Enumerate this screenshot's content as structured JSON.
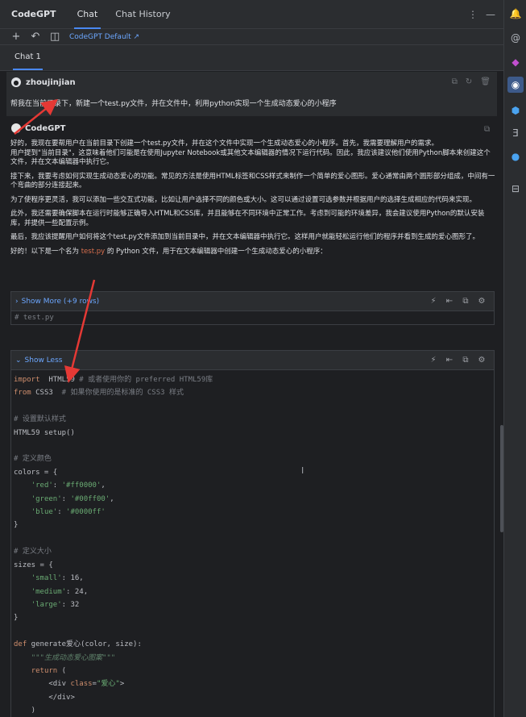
{
  "header": {
    "app_title": "CodeGPT",
    "tabs": [
      "Chat",
      "Chat History"
    ]
  },
  "toolbar": {
    "model_link": "CodeGPT Default ↗"
  },
  "chat_tab": "Chat 1",
  "user_message": {
    "username": "zhoujinjian",
    "text": "帮我在当前目录下，新建一个test.py文件，并在文件中，利用python实现一个生成动态爱心的小程序"
  },
  "bot_message": {
    "name": "CodeGPT",
    "paragraphs": [
      "好的，我现在要帮用户在当前目录下创建一个test.py文件，并在这个文件中实现一个生成动态爱心的小程序。首先，我需要理解用户的需求。",
      "用户提到\"当前目录\"，这意味着他们可能是在使用Jupyter Notebook或其他文本编辑器的情况下运行代码。因此，我应该建议他们使用Python脚本来创建这个文件，并在文本编辑器中执行它。",
      "接下来，我要考虑如何实现生成动态爱心的功能。常见的方法是使用HTML标签和CSS样式来制作一个简单的爱心图形。爱心通常由两个圆形部分组成，中间有一个弯曲的部分连接起来。",
      "为了使程序更灵活，我可以添加一些交互式功能，比如让用户选择不同的颜色或大小。这可以通过设置可选参数并根据用户的选择生成相应的代码来实现。",
      "此外，我还需要确保脚本在运行时能够正确导入HTML和CSS库，并且能够在不同环境中正常工作。考虑到可能的环境差异，我会建议使用Python的默认安装库，并提供一些配置示例。",
      "最后，我应该提醒用户如何将这个test.py文件添加到当前目录中，并在文本编辑器中执行它。这样用户就能轻松运行他们的程序并看到生成的爱心图形了。"
    ],
    "closing_prefix": "好的！以下是一个名为 ",
    "closing_file": "test.py",
    "closing_suffix": " 的 Python 文件，用于在文本编辑器中创建一个生成动态爱心的小程序："
  },
  "code_block_1": {
    "toggle_label": "Show More (+9 rows)",
    "first_line": "# test.py"
  },
  "code_block_2": {
    "toggle_label": "Show Less"
  },
  "code_lines": [
    [
      [
        "kw",
        "import"
      ],
      [
        "",
        "  HTML59 "
      ],
      [
        "cm",
        "# 或者使用你的 preferred HTML59库"
      ]
    ],
    [
      [
        "kw",
        "from"
      ],
      [
        "",
        " CSS3  "
      ],
      [
        "cm",
        "# 如果你使用的是标准的 CSS3 样式"
      ]
    ],
    [],
    [
      [
        "cm",
        "# 设置默认样式"
      ]
    ],
    [
      [
        "",
        "HTML59 setup()"
      ]
    ],
    [],
    [
      [
        "cm",
        "# 定义颜色"
      ]
    ],
    [
      [
        "",
        "colors = {"
      ]
    ],
    [
      [
        "",
        "    "
      ],
      [
        "st",
        "'red'"
      ],
      [
        "",
        ": "
      ],
      [
        "st",
        "'#ff0000'"
      ],
      [
        "",
        ","
      ]
    ],
    [
      [
        "",
        "    "
      ],
      [
        "st",
        "'green'"
      ],
      [
        "",
        ": "
      ],
      [
        "st",
        "'#00ff00'"
      ],
      [
        "",
        ","
      ]
    ],
    [
      [
        "",
        "    "
      ],
      [
        "st",
        "'blue'"
      ],
      [
        "",
        ": "
      ],
      [
        "st",
        "'#0000ff'"
      ]
    ],
    [
      [
        "",
        "}"
      ]
    ],
    [],
    [
      [
        "cm",
        "# 定义大小"
      ]
    ],
    [
      [
        "",
        "sizes = {"
      ]
    ],
    [
      [
        "",
        "    "
      ],
      [
        "st",
        "'small'"
      ],
      [
        "",
        ": 16,"
      ]
    ],
    [
      [
        "",
        "    "
      ],
      [
        "st",
        "'medium'"
      ],
      [
        "",
        ": 24,"
      ]
    ],
    [
      [
        "",
        "    "
      ],
      [
        "st",
        "'large'"
      ],
      [
        "",
        ": 32"
      ]
    ],
    [
      [
        "",
        "}"
      ]
    ],
    [],
    [
      [
        "kw",
        "def"
      ],
      [
        "",
        " generate爱心(color, size):"
      ]
    ],
    [
      [
        "",
        "    "
      ],
      [
        "dc",
        "\"\"\"生成动态爱心图案\"\"\""
      ]
    ],
    [
      [
        "",
        "    "
      ],
      [
        "kw",
        "return"
      ],
      [
        "",
        " ("
      ]
    ],
    [
      [
        "",
        "        <div "
      ],
      [
        "kw",
        "class"
      ],
      [
        "",
        "="
      ],
      [
        "st",
        "\"爱心\""
      ],
      [
        "",
        ">"
      ]
    ],
    [
      [
        "",
        "        </div>"
      ]
    ],
    [
      [
        "",
        "    )"
      ]
    ]
  ]
}
